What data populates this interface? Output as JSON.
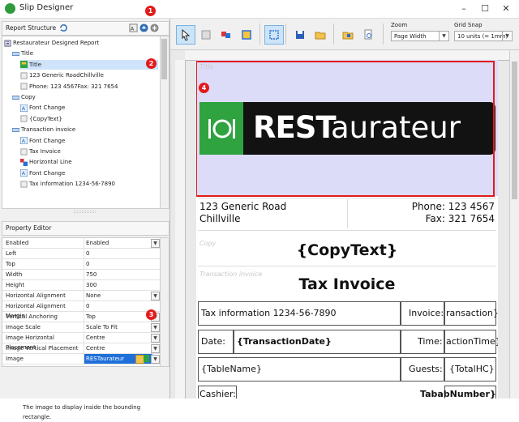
{
  "window": {
    "title": "Slip Designer",
    "controls": {
      "minimize": "–",
      "maximize": "☐",
      "close": "✕"
    }
  },
  "badges": [
    "1",
    "2",
    "3",
    "4"
  ],
  "report_structure": {
    "header": "Report Structure",
    "tree": [
      {
        "label": "Restaurateur Designed Report",
        "level": 0,
        "icon": "report-icon"
      },
      {
        "label": "Title",
        "level": 1,
        "icon": "band-icon"
      },
      {
        "label": "Title",
        "level": 2,
        "icon": "image-icon",
        "selected": true
      },
      {
        "label": "123 Generic RoadChillville",
        "level": 2,
        "icon": "text-icon"
      },
      {
        "label": "Phone: 123 4567Fax: 321 7654",
        "level": 2,
        "icon": "text-icon"
      },
      {
        "label": "Copy",
        "level": 1,
        "icon": "band-icon"
      },
      {
        "label": "Font Change",
        "level": 2,
        "icon": "font-icon"
      },
      {
        "label": "{CopyText}",
        "level": 2,
        "icon": "text-icon"
      },
      {
        "label": "Transaction invoice",
        "level": 1,
        "icon": "band-icon"
      },
      {
        "label": "Font Change",
        "level": 2,
        "icon": "font-icon"
      },
      {
        "label": "Tax Invoice",
        "level": 2,
        "icon": "text-icon"
      },
      {
        "label": "Horizontal Line",
        "level": 2,
        "icon": "line-icon"
      },
      {
        "label": "Font Change",
        "level": 2,
        "icon": "font-icon"
      },
      {
        "label": "Tax information 1234-56-7890",
        "level": 2,
        "icon": "text-icon"
      }
    ],
    "splitter": "::::::::::::::"
  },
  "property_editor": {
    "header": "Property Editor",
    "rows": [
      {
        "name": "Enabled",
        "value": "Enabled",
        "dropdown": true
      },
      {
        "name": "Left",
        "value": "0",
        "dropdown": false
      },
      {
        "name": "Top",
        "value": "0",
        "dropdown": false
      },
      {
        "name": "Width",
        "value": "750",
        "dropdown": false
      },
      {
        "name": "Height",
        "value": "300",
        "dropdown": false
      },
      {
        "name": "Horizontal Alignment",
        "value": "None",
        "dropdown": true
      },
      {
        "name": "Horizontal Alignment Margin",
        "value": "0",
        "dropdown": false
      },
      {
        "name": "Vertical Anchoring",
        "value": "Top",
        "dropdown": true
      },
      {
        "name": "Image Scale",
        "value": "Scale To Fit",
        "dropdown": true
      },
      {
        "name": "Image Horizontal Placement",
        "value": "Centre",
        "dropdown": true
      },
      {
        "name": "Image Vertical Placement",
        "value": "Centre",
        "dropdown": true
      },
      {
        "name": "Image",
        "value": "RESTaurateur",
        "dropdown": true,
        "selected": true
      }
    ],
    "help_text": "The image to display inside the bounding rectangle."
  },
  "toolbar": {
    "zoom_label": "Zoom",
    "zoom_value": "Page Width",
    "grid_label": "Grid Snap",
    "grid_value": "10 units (= 1mm)"
  },
  "slip": {
    "title_band": "Title",
    "copy_band": "Copy",
    "transaction_band": "Transaction invoice",
    "logo": {
      "bold": "REST",
      "light": "aurateur"
    },
    "address_line1": "123 Generic Road",
    "address_line2": "Chillville",
    "phone": "Phone: 123 4567",
    "fax": "Fax: 321 7654",
    "copy_text": "{CopyText}",
    "tax_invoice": "Tax Invoice",
    "tax_info": "Tax information 1234-56-7890",
    "invoice_label": "Invoice:",
    "invoice_value": "ransaction}",
    "date_label": "Date:",
    "date_value": "{TransactionDate}",
    "time_label": "Time:",
    "time_value": "actionTime}",
    "table_name": "{TableName}",
    "guests_label": "Guests:",
    "guests_value": "{TotalHC}",
    "cashier_label": "Cashier:",
    "tab_number": "TababNumber}"
  },
  "colors": {
    "accent": "#e31b1b",
    "selection": "#1e6fd9",
    "band": "#dcdcf8",
    "logo_green": "#2fa33f"
  }
}
